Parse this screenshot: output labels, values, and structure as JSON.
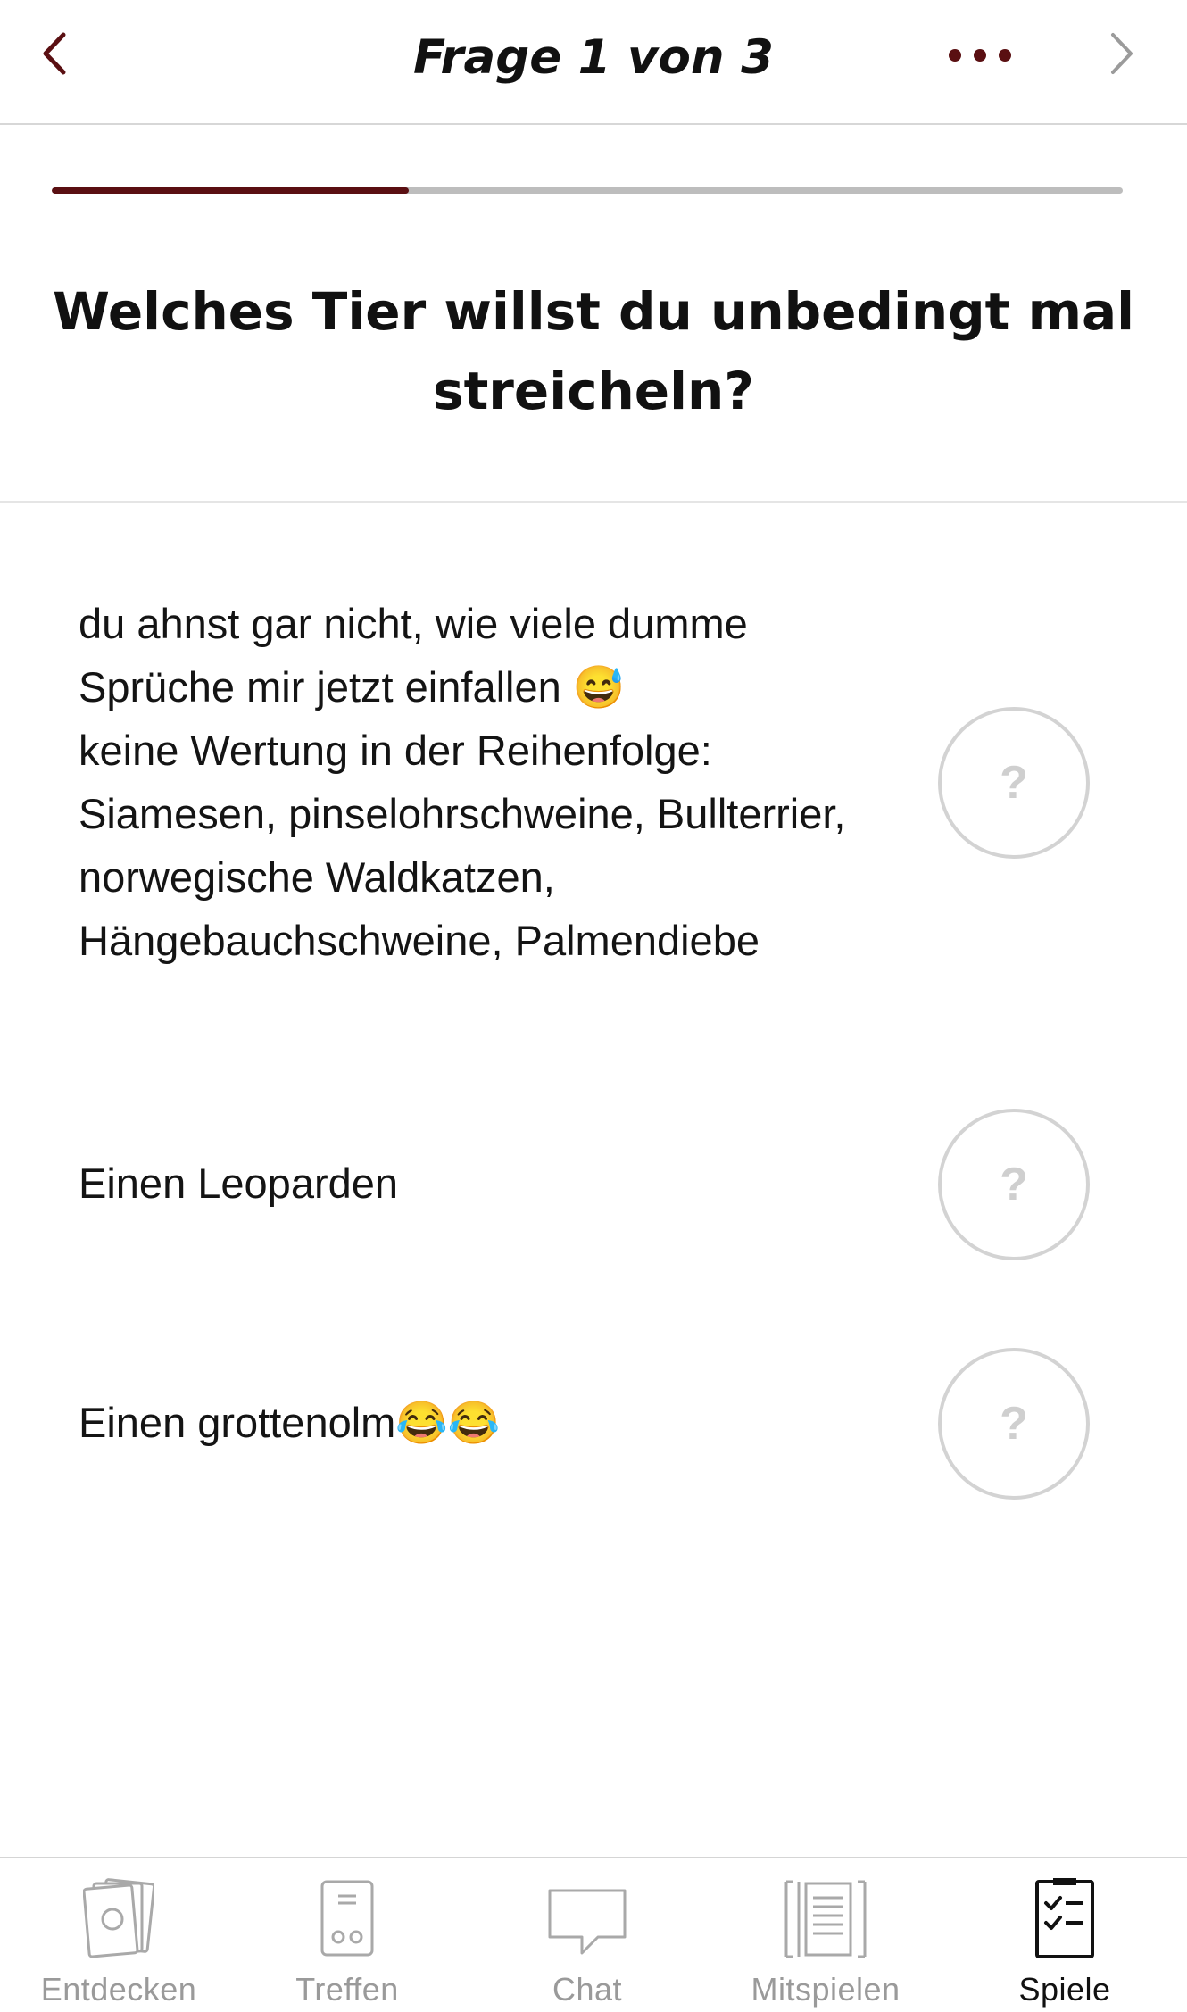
{
  "header": {
    "title": "Frage 1 von 3",
    "back_icon": "chevron-left-icon",
    "more_icon": "ellipsis-icon",
    "next_icon": "chevron-right-icon",
    "accent_color": "#5a0f12"
  },
  "progress": {
    "current": 1,
    "total": 3,
    "fraction": 0.333
  },
  "question": {
    "text": "Welches Tier willst du unbedingt mal streicheln?"
  },
  "answers": [
    {
      "text": "du ahnst gar nicht, wie viele dumme Sprüche mir jetzt einfallen 😅\nkeine Wertung in der Reihenfolge: Siamesen, pinselohrschweine, Bullterrier, norwegische Waldkatzen, Hängebauchschweine, Palmendiebe",
      "guess": "?"
    },
    {
      "text": "Einen Leoparden",
      "guess": "?"
    },
    {
      "text": "Einen grottenolm😂😂",
      "guess": "?"
    }
  ],
  "tabs": [
    {
      "label": "Entdecken",
      "icon": "cards-icon",
      "active": false
    },
    {
      "label": "Treffen",
      "icon": "phone-icon",
      "active": false
    },
    {
      "label": "Chat",
      "icon": "chat-bubble-icon",
      "active": false
    },
    {
      "label": "Mitspielen",
      "icon": "book-icon",
      "active": false
    },
    {
      "label": "Spiele",
      "icon": "checklist-icon",
      "active": true
    }
  ]
}
